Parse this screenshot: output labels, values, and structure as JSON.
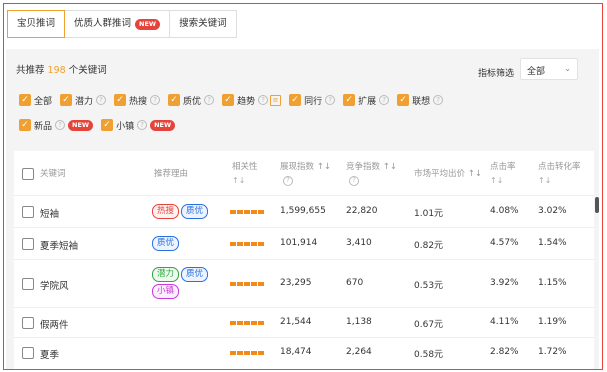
{
  "tabs": [
    {
      "label": "宝贝推词",
      "active": true
    },
    {
      "label": "优质人群推词",
      "badge": "NEW"
    },
    {
      "label": "搜索关键词"
    }
  ],
  "summary": {
    "prefix": "共推荐",
    "count": "198",
    "suffix": "个关键词"
  },
  "filter": {
    "label": "指标筛选",
    "value": "全部"
  },
  "checkbox_row1": [
    "全部",
    "潜力",
    "热搜",
    "质优",
    "趋势",
    "同行",
    "扩展",
    "联想"
  ],
  "checkbox_row2": [
    {
      "label": "新品",
      "badge": "NEW"
    },
    {
      "label": "小镇",
      "badge": "NEW"
    }
  ],
  "table": {
    "headers": {
      "keyword": "关键词",
      "reason": "推荐理由",
      "relevance": "相关性",
      "relevance_sort": "↑↓",
      "exposure": "展现指数 ↑↓",
      "competition": "竞争指数 ↑↓",
      "avg_bid": "市场平均出价 ↑↓",
      "ctr": "点击率",
      "ctr_sort": "↑↓",
      "cvr": "点击转化率",
      "cvr_sort": "↑↓"
    },
    "rows": [
      {
        "keyword": "短袖",
        "tags": [
          "热搜",
          "质优"
        ],
        "exposure": "1,599,655",
        "competition": "22,820",
        "avg_bid": "1.01元",
        "ctr": "4.08%",
        "cvr": "3.02%"
      },
      {
        "keyword": "夏季短袖",
        "tags": [
          "质优"
        ],
        "exposure": "101,914",
        "competition": "3,410",
        "avg_bid": "0.82元",
        "ctr": "4.57%",
        "cvr": "1.54%"
      },
      {
        "keyword": "学院风",
        "tags": [
          "潜力",
          "质优",
          "小镇"
        ],
        "exposure": "23,295",
        "competition": "670",
        "avg_bid": "0.53元",
        "ctr": "3.92%",
        "cvr": "1.15%"
      },
      {
        "keyword": "假两件",
        "tags": [],
        "exposure": "21,544",
        "competition": "1,138",
        "avg_bid": "0.67元",
        "ctr": "4.11%",
        "cvr": "1.19%"
      },
      {
        "keyword": "夏季",
        "tags": [],
        "exposure": "18,474",
        "competition": "2,264",
        "avg_bid": "0.58元",
        "ctr": "2.82%",
        "cvr": "1.72%"
      }
    ]
  },
  "colors": {
    "accent": "#f0a030",
    "frame": "#e5443b",
    "bars": "#f08a1a"
  }
}
